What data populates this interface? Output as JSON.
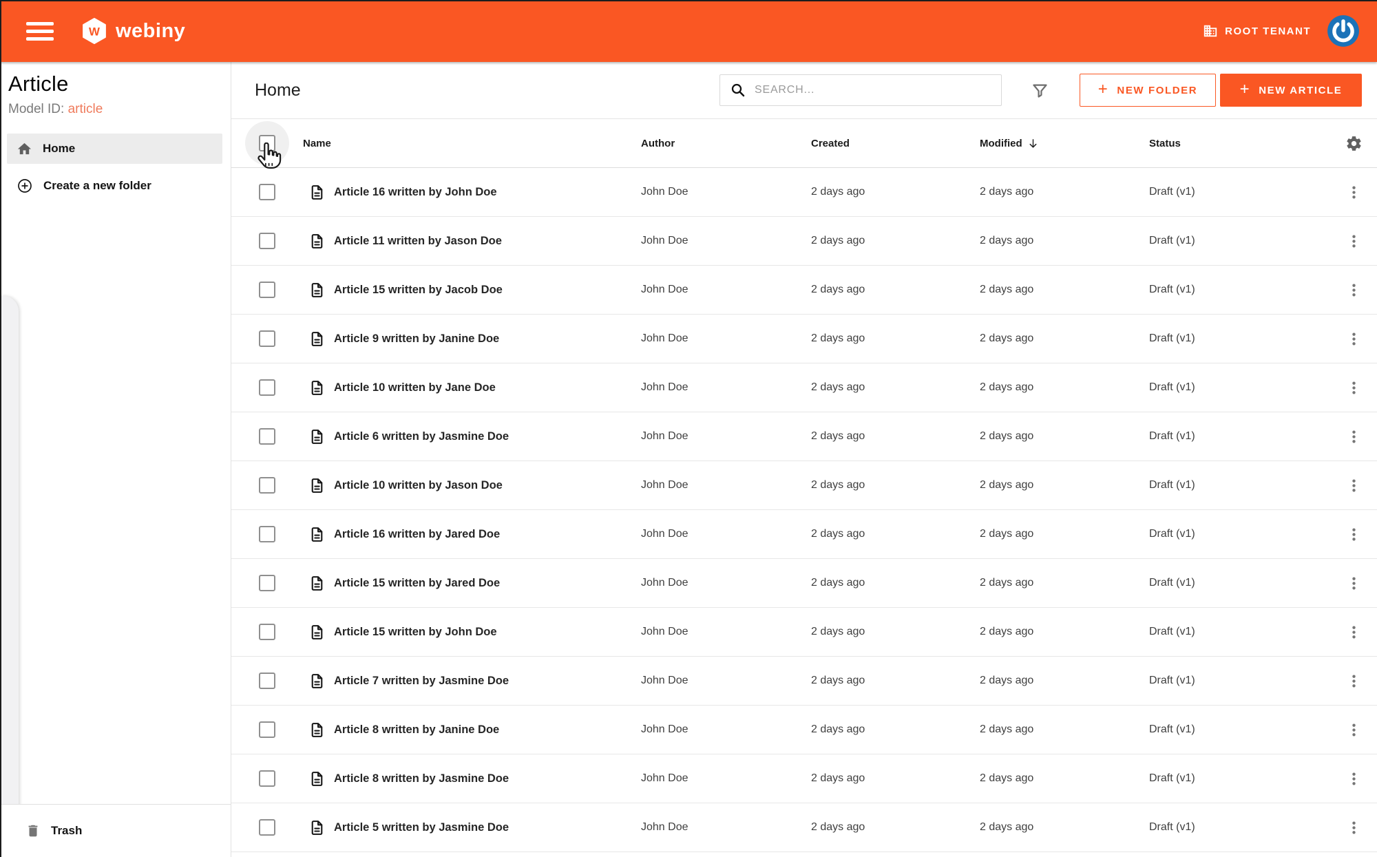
{
  "topbar": {
    "brand": "webiny",
    "brand_initial": "W",
    "tenant_label": "ROOT TENANT",
    "colors": {
      "header_bg": "#FA5723",
      "accent": "#FA5723",
      "avatar_blue": "#1B72B8"
    }
  },
  "sidebar": {
    "title": "Article",
    "model_id_label": "Model ID:",
    "model_id_value": "article",
    "items": [
      {
        "label": "Home",
        "active": true
      },
      {
        "label": "Create a new folder",
        "active": false
      }
    ],
    "trash_label": "Trash"
  },
  "content": {
    "heading": "Home",
    "search_placeholder": "SEARCH...",
    "new_folder_label": "NEW FOLDER",
    "new_article_label": "NEW ARTICLE",
    "plus_glyph": "+"
  },
  "table": {
    "columns": [
      "Name",
      "Author",
      "Created",
      "Modified",
      "Status"
    ],
    "sort": {
      "column": "Modified",
      "direction": "desc"
    },
    "rows": [
      {
        "name": "Article 16 written by John Doe",
        "author": "John Doe",
        "created": "2 days ago",
        "modified": "2 days ago",
        "status": "Draft (v1)"
      },
      {
        "name": "Article 11 written by Jason Doe",
        "author": "John Doe",
        "created": "2 days ago",
        "modified": "2 days ago",
        "status": "Draft (v1)"
      },
      {
        "name": "Article 15 written by Jacob Doe",
        "author": "John Doe",
        "created": "2 days ago",
        "modified": "2 days ago",
        "status": "Draft (v1)"
      },
      {
        "name": "Article 9 written by Janine Doe",
        "author": "John Doe",
        "created": "2 days ago",
        "modified": "2 days ago",
        "status": "Draft (v1)"
      },
      {
        "name": "Article 10 written by Jane Doe",
        "author": "John Doe",
        "created": "2 days ago",
        "modified": "2 days ago",
        "status": "Draft (v1)"
      },
      {
        "name": "Article 6 written by Jasmine Doe",
        "author": "John Doe",
        "created": "2 days ago",
        "modified": "2 days ago",
        "status": "Draft (v1)"
      },
      {
        "name": "Article 10 written by Jason Doe",
        "author": "John Doe",
        "created": "2 days ago",
        "modified": "2 days ago",
        "status": "Draft (v1)"
      },
      {
        "name": "Article 16 written by Jared Doe",
        "author": "John Doe",
        "created": "2 days ago",
        "modified": "2 days ago",
        "status": "Draft (v1)"
      },
      {
        "name": "Article 15 written by Jared Doe",
        "author": "John Doe",
        "created": "2 days ago",
        "modified": "2 days ago",
        "status": "Draft (v1)"
      },
      {
        "name": "Article 15 written by John Doe",
        "author": "John Doe",
        "created": "2 days ago",
        "modified": "2 days ago",
        "status": "Draft (v1)"
      },
      {
        "name": "Article 7 written by Jasmine Doe",
        "author": "John Doe",
        "created": "2 days ago",
        "modified": "2 days ago",
        "status": "Draft (v1)"
      },
      {
        "name": "Article 8 written by Janine Doe",
        "author": "John Doe",
        "created": "2 days ago",
        "modified": "2 days ago",
        "status": "Draft (v1)"
      },
      {
        "name": "Article 8 written by Jasmine Doe",
        "author": "John Doe",
        "created": "2 days ago",
        "modified": "2 days ago",
        "status": "Draft (v1)"
      },
      {
        "name": "Article 5 written by Jasmine Doe",
        "author": "John Doe",
        "created": "2 days ago",
        "modified": "2 days ago",
        "status": "Draft (v1)"
      }
    ]
  }
}
